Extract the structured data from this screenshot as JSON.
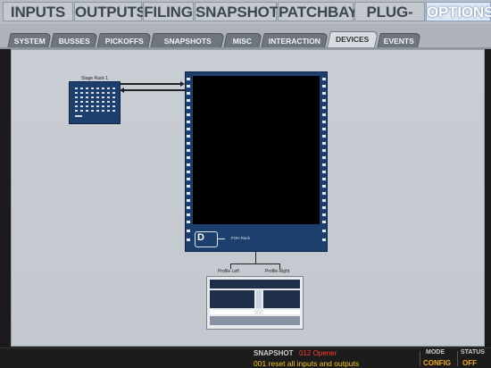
{
  "top_tabs": [
    {
      "label": "INPUTS"
    },
    {
      "label": "OUTPUTS"
    },
    {
      "label": "FILING"
    },
    {
      "label": "SNAPSHOTS"
    },
    {
      "label": "PATCHBAY"
    },
    {
      "label": "PLUG-INS"
    },
    {
      "label": "OPTIONS",
      "active": true
    }
  ],
  "sub_tabs": [
    {
      "label": "SYSTEM"
    },
    {
      "label": "BUSSES"
    },
    {
      "label": "PICKOFFS"
    },
    {
      "label": "SNAPSHOTS"
    },
    {
      "label": "MISC"
    },
    {
      "label": "INTERACTION"
    },
    {
      "label": "DEVICES",
      "active": true
    },
    {
      "label": "EVENTS"
    }
  ],
  "devices": {
    "stage_rack_label": "Stage Rack 1",
    "engine_label": "FOH Rack",
    "profile_left_label": "Profile Left",
    "profile_right_label": "Profile Right"
  },
  "status_bar": {
    "snapshot_label": "SNAPSHOT",
    "snapshot_name": "012 Opener",
    "snapshot_description": "001 reset all inputs and outputs",
    "mode_label": "MODE",
    "mode_value": "CONFIG",
    "status_label": "STATUS",
    "status_value": "OFF"
  },
  "colors": {
    "accent_blue": "#1d3f6d",
    "snapshot_name": "#ff3b2a",
    "snapshot_desc": "#f0c418",
    "mode_status": "#f5a623"
  }
}
